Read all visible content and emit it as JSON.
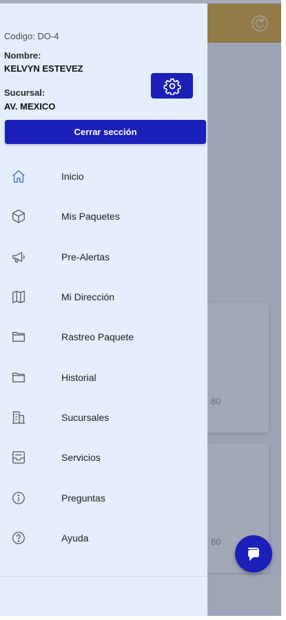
{
  "user": {
    "code": "Codigo: DO-4",
    "name_label": "Nombre:",
    "name_value": "KELVYN ESTEVEZ",
    "branch_label": "Sucursal:",
    "branch_value": "AV. MEXICO"
  },
  "drawer": {
    "logout_label": "Cerrar sección",
    "settings_icon": "gear-icon",
    "menu": [
      {
        "label": "Inicio",
        "icon": "home-icon"
      },
      {
        "label": "Mis Paquetes",
        "icon": "package-icon"
      },
      {
        "label": "Pre-Alertas",
        "icon": "megaphone-icon"
      },
      {
        "label": "Mi Dirección",
        "icon": "map-icon"
      },
      {
        "label": "Rastreo Paquete",
        "icon": "folder-icon"
      },
      {
        "label": "Historial",
        "icon": "folder-icon"
      },
      {
        "label": "Sucursales",
        "icon": "building-icon"
      },
      {
        "label": "Servicios",
        "icon": "inbox-icon"
      },
      {
        "label": "Preguntas",
        "icon": "info-icon"
      },
      {
        "label": "Ayuda",
        "icon": "help-icon"
      }
    ]
  },
  "background": {
    "card_1_value": "80",
    "card_2_value": "80"
  },
  "colors": {
    "header": "#d9a431",
    "primary": "#1a20b8",
    "drawer_bg": "#e4eefc",
    "active_icon": "#3f6fd6"
  }
}
